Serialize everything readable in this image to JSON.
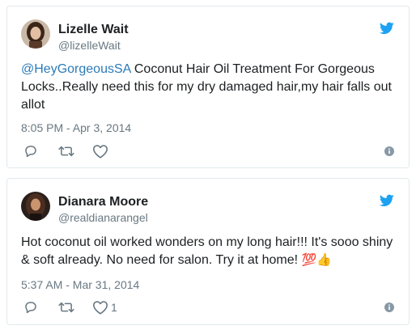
{
  "colors": {
    "twitter_blue": "#1da1f2",
    "link": "#2b7bb9",
    "meta_gray": "#697882",
    "border": "#e1e8ed"
  },
  "tweets": [
    {
      "author_name": "Lizelle Wait",
      "handle": "@lizelleWait",
      "mention": "@HeyGorgeousSA",
      "text": " Coconut Hair Oil Treatment For Gorgeous Locks..Really need this for my dry damaged hair,my hair falls out allot",
      "emoji": "",
      "timestamp": "8:05 PM - Apr 3, 2014",
      "like_count": "",
      "icons": [
        "avatar",
        "twitter-bird-icon",
        "reply-icon",
        "retweet-icon",
        "like-icon",
        "info-icon"
      ]
    },
    {
      "author_name": "Dianara Moore",
      "handle": "@realdianarangel",
      "mention": "",
      "text": "Hot coconut oil worked wonders on my long hair!!! It's sooo shiny & soft already. No need for salon. Try it at home! ",
      "emoji": "💯👍",
      "timestamp": "5:37 AM - Mar 31, 2014",
      "like_count": "1",
      "icons": [
        "avatar",
        "twitter-bird-icon",
        "reply-icon",
        "retweet-icon",
        "like-icon",
        "info-icon"
      ]
    }
  ]
}
